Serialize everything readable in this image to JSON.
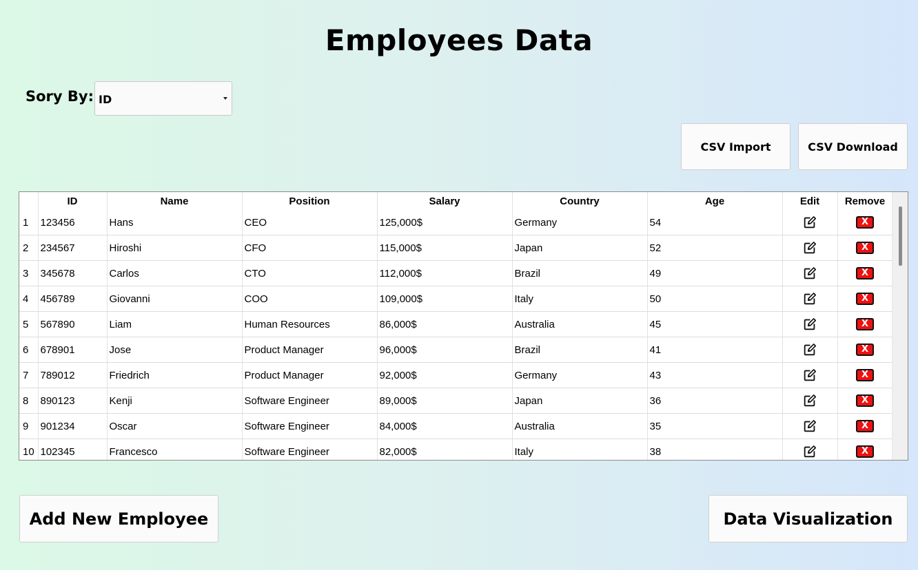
{
  "title": "Employees Data",
  "sort": {
    "label": "Sory By:",
    "selected": "ID"
  },
  "buttons": {
    "csv_import": "CSV Import",
    "csv_download": "CSV Download",
    "add_employee": "Add New Employee",
    "data_visualization": "Data Visualization"
  },
  "table": {
    "headers": [
      "ID",
      "Name",
      "Position",
      "Salary",
      "Country",
      "Age",
      "Edit",
      "Remove"
    ],
    "remove_glyph": "X",
    "rows": [
      {
        "num": "1",
        "id": "123456",
        "name": "Hans",
        "position": "CEO",
        "salary": "125,000$",
        "country": "Germany",
        "age": "54"
      },
      {
        "num": "2",
        "id": "234567",
        "name": "Hiroshi",
        "position": "CFO",
        "salary": "115,000$",
        "country": "Japan",
        "age": "52"
      },
      {
        "num": "3",
        "id": "345678",
        "name": "Carlos",
        "position": "CTO",
        "salary": "112,000$",
        "country": "Brazil",
        "age": "49"
      },
      {
        "num": "4",
        "id": "456789",
        "name": "Giovanni",
        "position": "COO",
        "salary": "109,000$",
        "country": "Italy",
        "age": "50"
      },
      {
        "num": "5",
        "id": "567890",
        "name": "Liam",
        "position": "Human Resources",
        "salary": "86,000$",
        "country": "Australia",
        "age": "45"
      },
      {
        "num": "6",
        "id": "678901",
        "name": "Jose",
        "position": "Product Manager",
        "salary": "96,000$",
        "country": "Brazil",
        "age": "41"
      },
      {
        "num": "7",
        "id": "789012",
        "name": "Friedrich",
        "position": "Product Manager",
        "salary": "92,000$",
        "country": "Germany",
        "age": "43"
      },
      {
        "num": "8",
        "id": "890123",
        "name": "Kenji",
        "position": "Software Engineer",
        "salary": "89,000$",
        "country": "Japan",
        "age": "36"
      },
      {
        "num": "9",
        "id": "901234",
        "name": "Oscar",
        "position": "Software Engineer",
        "salary": "84,000$",
        "country": "Australia",
        "age": "35"
      },
      {
        "num": "10",
        "id": "102345",
        "name": "Francesco",
        "position": "Software Engineer",
        "salary": "82,000$",
        "country": "Italy",
        "age": "38"
      }
    ]
  }
}
